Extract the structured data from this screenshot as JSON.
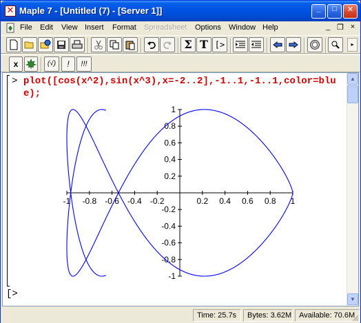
{
  "window": {
    "title": "Maple 7  - [Untitled (7) - [Server 1]]",
    "app_icon_glyph": "✕",
    "buttons": {
      "minimize": "_",
      "maximize": "□",
      "close": "✕"
    }
  },
  "menu": {
    "items": [
      "File",
      "Edit",
      "View",
      "Insert",
      "Format",
      "Spreadsheet",
      "Options",
      "Window",
      "Help"
    ],
    "disabled": [
      "Spreadsheet"
    ],
    "mdi_buttons": {
      "minimize": "_",
      "restore": "❐",
      "close": "×"
    }
  },
  "toolbar1": {
    "buttons": [
      "new-icon",
      "open-icon",
      "open-url-icon",
      "save-icon",
      "print-icon",
      "cut-icon",
      "copy-icon",
      "paste-icon",
      "undo-icon",
      "redo-icon",
      "sum-icon",
      "text-icon",
      "execution-group-icon",
      "indent-icon",
      "outdent-icon",
      "back-icon",
      "forward-icon",
      "stop-icon",
      "zoom-icon"
    ],
    "sum_label": "Σ",
    "text_label": "T",
    "exec_label": "[>"
  },
  "toolbar2": {
    "buttons": [
      "inert-text-icon",
      "maple-leaf-icon",
      "expression-icon",
      "execute-icon",
      "execute-all-icon"
    ],
    "x_label": "x",
    "expr_label": "(√)",
    "exec_label": "!",
    "exec_all_label": "!!!"
  },
  "worksheet": {
    "command_prompt": ">",
    "command": "plot([cos(x^2),sin(x^3),x=-2..2],-1..1,-1..1,color=blue);",
    "empty_prompt": "[>"
  },
  "chart_data": {
    "type": "line",
    "parametric": {
      "x": "cos(t^2)",
      "y": "sin(t^3)",
      "t_range": [
        -2,
        2
      ]
    },
    "xlim": [
      -1,
      1
    ],
    "ylim": [
      -1,
      1
    ],
    "x_ticks": [
      "-1",
      "-0.8",
      "-0.6",
      "-0.4",
      "-0.2",
      "0",
      "0.2",
      "0.4",
      "0.6",
      "0.8",
      "1"
    ],
    "y_ticks": [
      "1",
      "0.8",
      "0.6",
      "0.4",
      "0.2",
      "-0.2",
      "-0.4",
      "-0.6",
      "-0.8",
      "-1"
    ],
    "series": [
      {
        "color": "#0000ff"
      }
    ]
  },
  "status": {
    "time": "Time:  25.7s",
    "bytes": "Bytes: 3.62M",
    "available": "Available: 70.6M"
  },
  "colors": {
    "title_bar": "#0054e3",
    "command_text": "#d00000",
    "plot_line": "#0000ff"
  }
}
